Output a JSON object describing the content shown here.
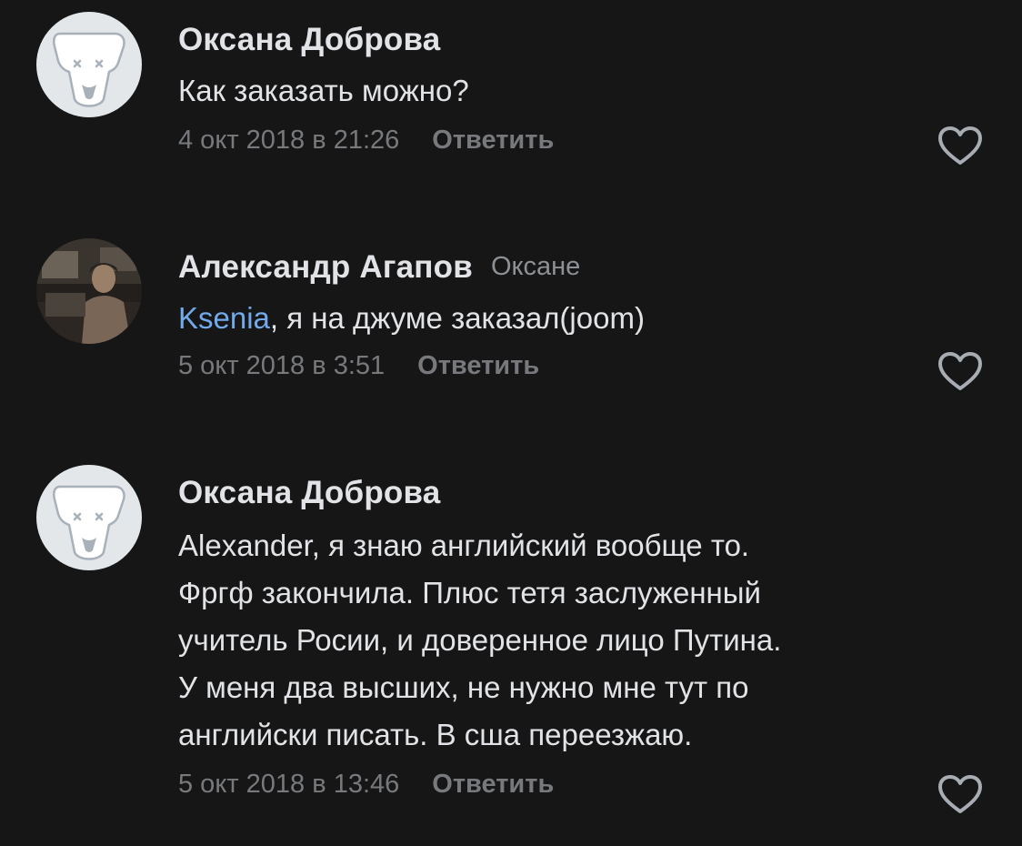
{
  "comments": [
    {
      "author": "Оксана Доброва",
      "reply_to": "",
      "mention": "",
      "text": "Как заказать можно?",
      "date": "4 окт 2018 в 21:26",
      "reply_label": "Ответить",
      "avatar_icon": "default-dog-avatar-icon",
      "like_icon": "heart-outline-icon"
    },
    {
      "author": "Александр Агапов",
      "reply_to": "Оксане",
      "mention": "Ksenia",
      "text": ", я на джуме заказал(joom)",
      "date": "5 окт 2018 в 3:51",
      "reply_label": "Ответить",
      "avatar_icon": "user-photo-avatar",
      "like_icon": "heart-outline-icon"
    },
    {
      "author": "Оксана Доброва",
      "reply_to": "",
      "mention": "",
      "text_lines": [
        "Alexander, я знаю английский вообще то.",
        "Фргф закончила. Плюс тетя заслуженный",
        "учитель Росии, и доверенное лицо Путина.",
        "У меня два высших, не нужно мне тут по",
        "английски писать. В сша переезжаю."
      ],
      "date": "5 окт 2018 в 13:46",
      "reply_label": "Ответить",
      "avatar_icon": "default-dog-avatar-icon",
      "like_icon": "heart-outline-icon"
    }
  ],
  "colors": {
    "background": "#161616",
    "text": "#e1e3e6",
    "secondary": "#77797c",
    "mention": "#71aaeb"
  }
}
